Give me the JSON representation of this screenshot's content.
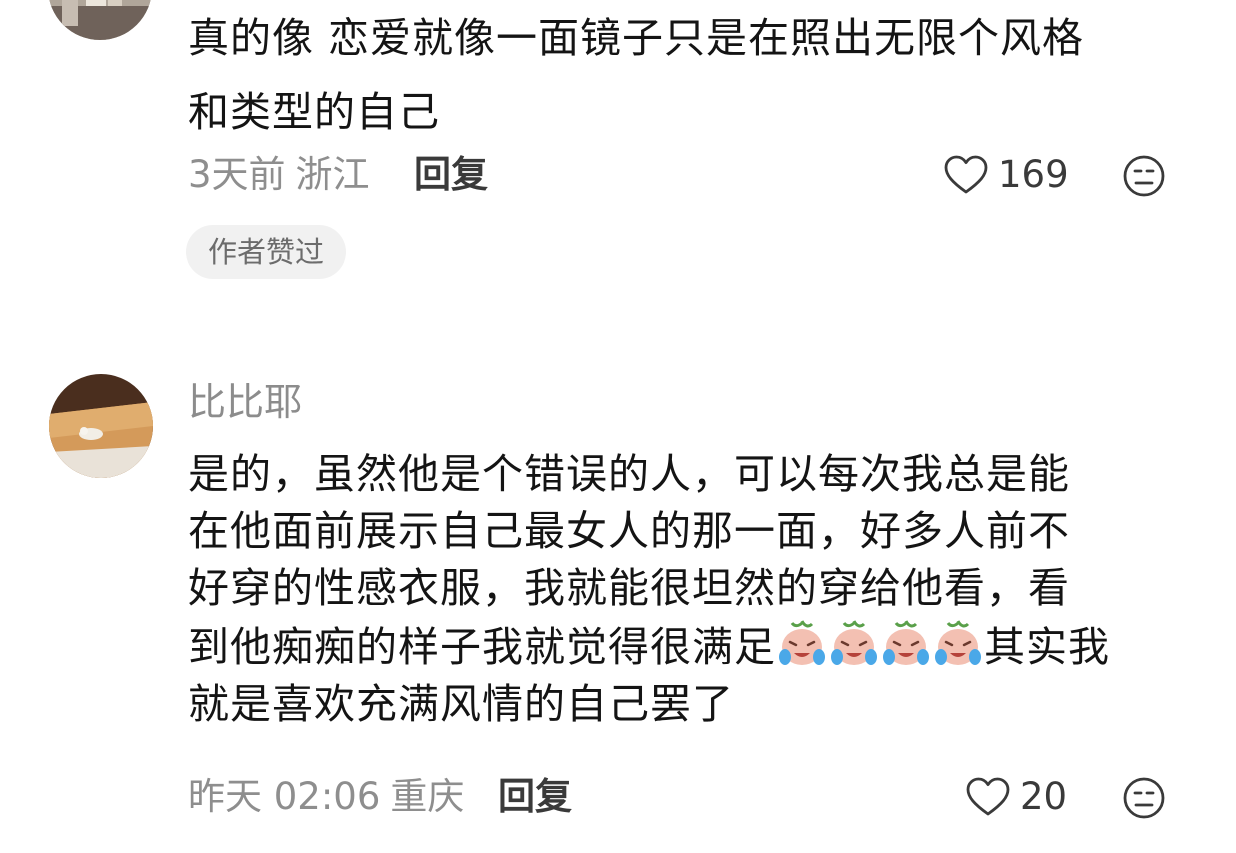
{
  "comments": [
    {
      "avatar": "user-avatar",
      "content_lines": [
        "真的像 恋爱就像一面镜子只是在照出无限个风格",
        "和类型的自己"
      ],
      "time": "3天前",
      "location": "浙江",
      "reply_label": "回复",
      "like_count": "169",
      "badge": "作者赞过"
    },
    {
      "avatar": "user-avatar",
      "username": "比比耶",
      "content_lines": [
        "是的，虽然他是个错误的人，可以每次我总是能",
        "在他面前展示自己最女人的那一面，好多人前不",
        "好穿的性感衣服，我就能很坦然的穿给他看，看",
        "到他痴痴的样子我就觉得很满足",
        "其实我",
        "就是喜欢充满风情的自己罢了"
      ],
      "emoji_name": "crying-face-emoji",
      "emoji_count": 4,
      "time": "昨天 02:06",
      "location": "重庆",
      "reply_label": "回复",
      "like_count": "20"
    }
  ],
  "icons": {
    "like": "heart-outline-icon",
    "dislike": "neutral-face-icon"
  },
  "colors": {
    "text": "#141414",
    "meta": "#8e8e8e",
    "badge_bg": "#f1f1f1"
  }
}
